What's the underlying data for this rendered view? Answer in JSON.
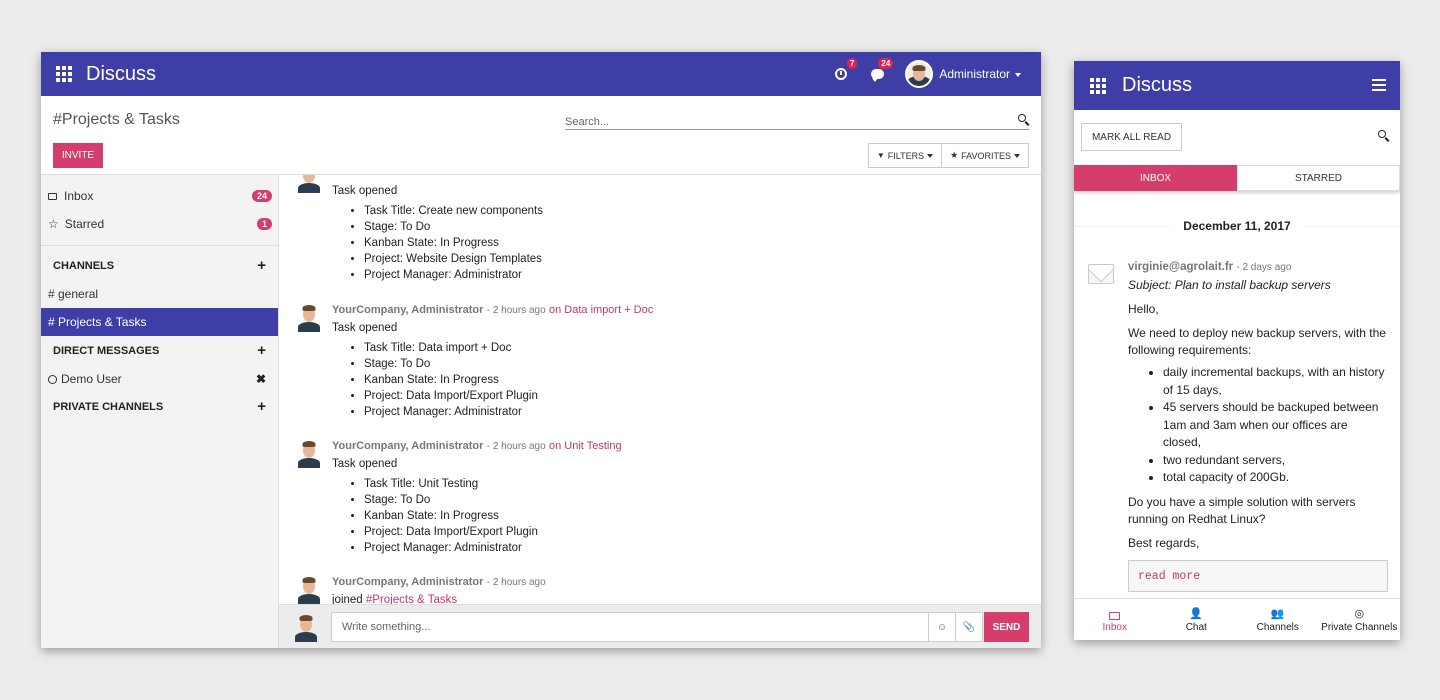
{
  "desktop": {
    "app_title": "Discuss",
    "activity_badge": "7",
    "messages_badge": "24",
    "user_name": "Administrator",
    "breadcrumb": "#Projects & Tasks",
    "search_placeholder": "Search...",
    "invite_label": "INVITE",
    "filters_label": "FILTERS",
    "favorites_label": "FAVORITES",
    "sidebar": {
      "inbox_label": "Inbox",
      "inbox_count": "24",
      "starred_label": "Starred",
      "starred_count": "1",
      "channels_header": "CHANNELS",
      "channel_general": "# general",
      "channel_projects": "# Projects & Tasks",
      "dm_header": "DIRECT MESSAGES",
      "dm_demo": "Demo User",
      "private_header": "PRIVATE CHANNELS"
    },
    "messages": [
      {
        "text": "Task opened",
        "items": [
          "Task Title: Create new components",
          "Stage: To Do",
          "Kanban State: In Progress",
          "Project: Website Design Templates",
          "Project Manager: Administrator"
        ]
      },
      {
        "author": "YourCompany, Administrator",
        "time": "- 2 hours ago",
        "link": "on Data import + Doc",
        "text": "Task opened",
        "items": [
          "Task Title: Data import + Doc",
          "Stage: To Do",
          "Kanban State: In Progress",
          "Project: Data Import/Export Plugin",
          "Project Manager: Administrator"
        ]
      },
      {
        "author": "YourCompany, Administrator",
        "time": "- 2 hours ago",
        "link": "on Unit Testing",
        "text": "Task opened",
        "items": [
          "Task Title: Unit Testing",
          "Stage: To Do",
          "Kanban State: In Progress",
          "Project: Data Import/Export Plugin",
          "Project Manager: Administrator"
        ]
      },
      {
        "author": "YourCompany, Administrator",
        "time": "- 2 hours ago",
        "text": "joined",
        "channel_link": "#Projects & Tasks"
      }
    ],
    "composer_placeholder": "Write something...",
    "send_label": "SEND"
  },
  "mobile": {
    "app_title": "Discuss",
    "mark_all_read": "MARK ALL READ",
    "tabs": [
      "INBOX",
      "STARRED"
    ],
    "date": "December 11, 2017",
    "email": {
      "from": "virginie@agrolait.fr",
      "time": "- 2 days ago",
      "subject": "Subject: Plan to install backup servers",
      "greeting": "Hello,",
      "intro": "We need to deploy new backup servers, with the following requirements:",
      "items": [
        "daily incremental backups, with an history of 15 days,",
        "45 servers should be backuped between 1am and 3am when our offices are closed,",
        "two redundant servers,",
        "total capacity of 200Gb."
      ],
      "question": "Do you have a simple solution with servers running on Redhat Linux?",
      "closing": "Best regards,",
      "read_more": "read more"
    },
    "nav": [
      "Inbox",
      "Chat",
      "Channels",
      "Private Channels"
    ]
  },
  "colors": {
    "brand": "#3f3ea7",
    "accent": "#d43d6c"
  },
  "icons": [
    "apps-grid-icon",
    "clock-icon",
    "chat-bubble-icon",
    "inbox-icon",
    "star-icon",
    "plus-icon",
    "search-icon",
    "menu-icon",
    "envelope-icon",
    "user-icon",
    "users-icon",
    "eye-slash-icon",
    "smile-icon",
    "paperclip-icon"
  ]
}
